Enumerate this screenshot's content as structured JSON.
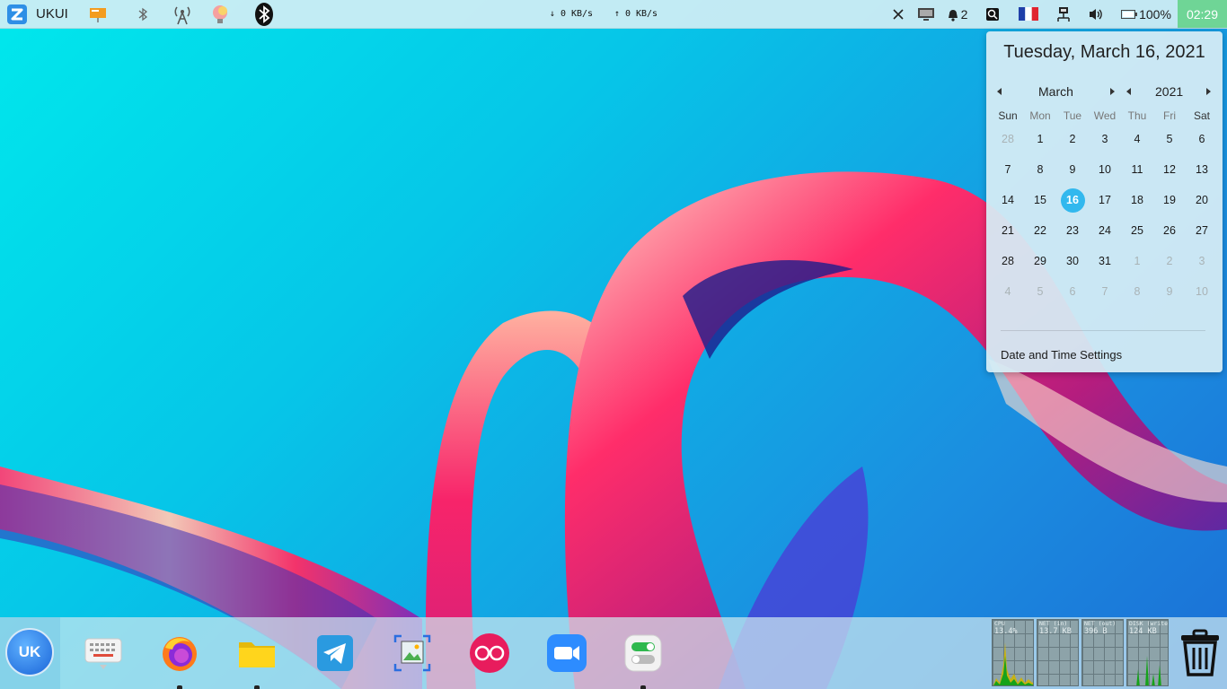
{
  "top_panel": {
    "start_label": "UKUI",
    "net_down": "↓ 0 KB/s",
    "net_up": "↑ 0 KB/s",
    "notification_count": "2",
    "battery": "100%",
    "clock": "02:29",
    "tray_icons": [
      "ukui-logo-icon",
      "presentation-board-icon",
      "bluetooth-small-icon",
      "wifi-antenna-icon",
      "brain-bulb-icon",
      "bluetooth-icon",
      "close-icon",
      "screen-icon",
      "notification-icon",
      "app-tray-icon",
      "france-flag-icon",
      "network-wired-icon",
      "volume-icon",
      "battery-icon"
    ]
  },
  "calendar": {
    "full_date": "Tuesday, March 16, 2021",
    "month": "March",
    "year": "2021",
    "weekdays": [
      "Sun",
      "Mon",
      "Tue",
      "Wed",
      "Thu",
      "Fri",
      "Sat"
    ],
    "weeks": [
      [
        "28",
        "1",
        "2",
        "3",
        "4",
        "5",
        "6"
      ],
      [
        "7",
        "8",
        "9",
        "10",
        "11",
        "12",
        "13"
      ],
      [
        "14",
        "15",
        "16",
        "17",
        "18",
        "19",
        "20"
      ],
      [
        "21",
        "22",
        "23",
        "24",
        "25",
        "26",
        "27"
      ],
      [
        "28",
        "29",
        "30",
        "31",
        "1",
        "2",
        "3"
      ],
      [
        "4",
        "5",
        "6",
        "7",
        "8",
        "9",
        "10"
      ]
    ],
    "today": "16",
    "settings_link": "Date and Time Settings"
  },
  "taskbar": {
    "start_logo": "UK",
    "apps": [
      "keyboard-icon",
      "firefox-icon",
      "file-manager-icon",
      "telegram-icon",
      "screenshot-icon",
      "flickr-icon",
      "zoom-icon",
      "settings-toggle-icon",
      "trash-icon"
    ],
    "monitors": [
      {
        "label": "CPU",
        "value": "13.4%"
      },
      {
        "label": "NET (in)",
        "value": "13.7 KB"
      },
      {
        "label": "NET (out)",
        "value": "396 B"
      },
      {
        "label": "DISK (write)",
        "value": "124 KB"
      }
    ]
  },
  "colors": {
    "today_highlight": "#32b8ee",
    "clock_bg": "#6fd596",
    "panel_bg": "#d2eef4"
  }
}
